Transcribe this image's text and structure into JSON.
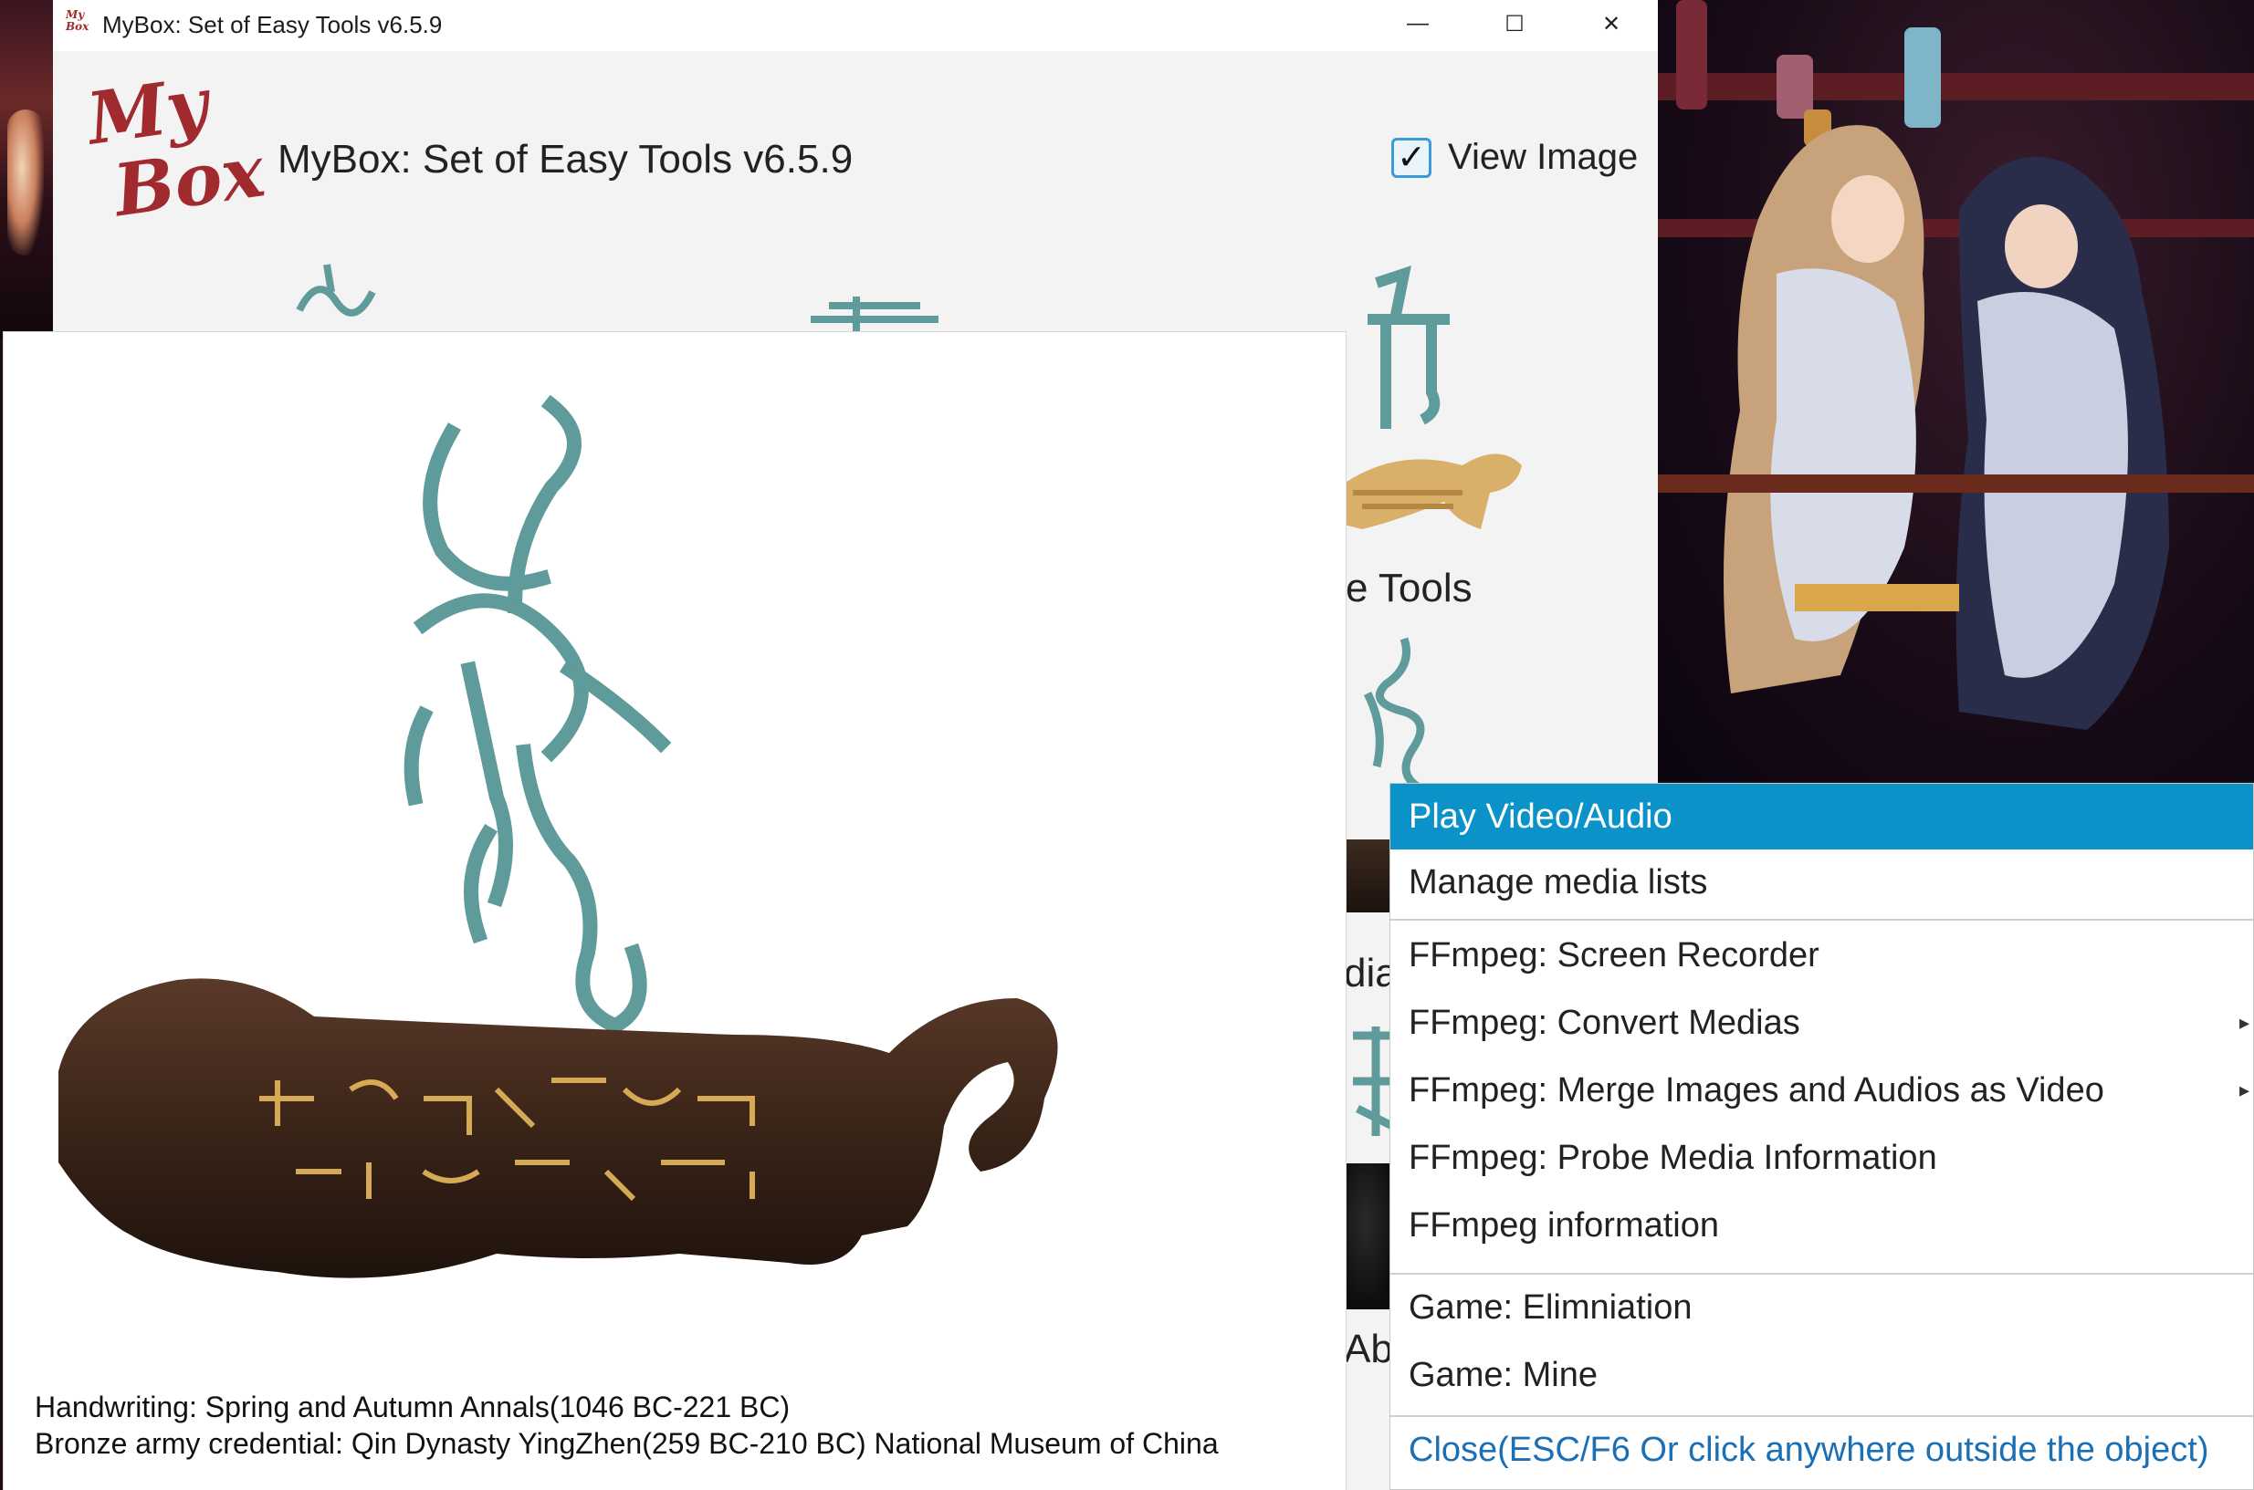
{
  "window": {
    "title": "MyBox: Set of Easy Tools v6.5.9",
    "icon_text_1": "My",
    "icon_text_2": "Box",
    "minimize_icon": "minimize-icon",
    "maximize_icon": "maximize-icon",
    "close_icon": "close-icon",
    "min_glyph": "—",
    "max_glyph": "☐",
    "close_glyph": "✕"
  },
  "header": {
    "logo_line_1": "My",
    "logo_line_2": "Box",
    "title": "MyBox: Set of Easy Tools v6.5.9",
    "view_image_label": "View Image",
    "view_image_checked": true,
    "check_glyph": "✓"
  },
  "background_labels": {
    "tools": "e Tools",
    "media": "dia",
    "about": "Abo"
  },
  "preview": {
    "caption_1": "Handwriting: Spring and Autumn Annals(1046 BC-221 BC)",
    "caption_2": "Bronze army credential: Qin Dynasty YingZhen(259 BC-210 BC) National Museum of China"
  },
  "context_menu": {
    "items": [
      {
        "label": "Play Video/Audio",
        "active": true,
        "submenu": false
      },
      {
        "label": "Manage media lists",
        "active": false,
        "submenu": false
      },
      {
        "label": "FFmpeg: Screen Recorder",
        "active": false,
        "submenu": false
      },
      {
        "label": "FFmpeg: Convert Medias",
        "active": false,
        "submenu": true
      },
      {
        "label": "FFmpeg: Merge Images and Audios as Video",
        "active": false,
        "submenu": true
      },
      {
        "label": "FFmpeg: Probe Media Information",
        "active": false,
        "submenu": false
      },
      {
        "label": "FFmpeg information",
        "active": false,
        "submenu": false
      },
      {
        "label": "Game: Elimniation",
        "active": false,
        "submenu": false
      },
      {
        "label": "Game: Mine",
        "active": false,
        "submenu": false
      }
    ],
    "close_label": "Close(ESC/F6 Or click anywhere outside the object)",
    "submenu_arrow": "▸"
  },
  "colors": {
    "accent": "#0b93c9",
    "logo_red": "#a12a2f",
    "seal_teal": "#5f9b9b",
    "close_link": "#1b6fb5"
  }
}
